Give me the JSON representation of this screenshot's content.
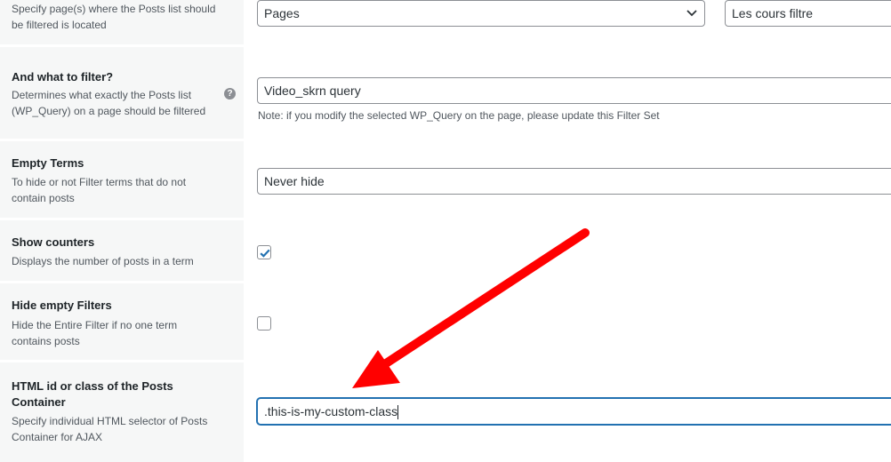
{
  "rows": [
    {
      "desc": "Specify page(s) where the Posts list should be filtered is located",
      "select_value": "Pages",
      "select2_value": "Les cours filtre"
    },
    {
      "title": "And what to filter?",
      "desc": "Determines what exactly the Posts list (WP_Query) on a page should be filtered",
      "help_icon": "?",
      "value": "Video_skrn query",
      "note": "Note: if you modify the selected WP_Query on the page, please update this Filter Set"
    },
    {
      "title": "Empty Terms",
      "desc": "To hide or not Filter terms that do not contain posts",
      "value": "Never hide"
    },
    {
      "title": "Show counters",
      "desc": "Displays the number of posts in a term",
      "checked": true
    },
    {
      "title": "Hide empty Filters",
      "desc": "Hide the Entire Filter if no one term contains posts",
      "checked": false
    },
    {
      "title": "HTML id or class of the Posts Container",
      "desc": "Specify individual HTML selector of Posts Container for AJAX",
      "value": ".this-is-my-custom-class"
    }
  ],
  "annotation": {
    "icon": "red-arrow-icon",
    "color": "#ff0000"
  }
}
